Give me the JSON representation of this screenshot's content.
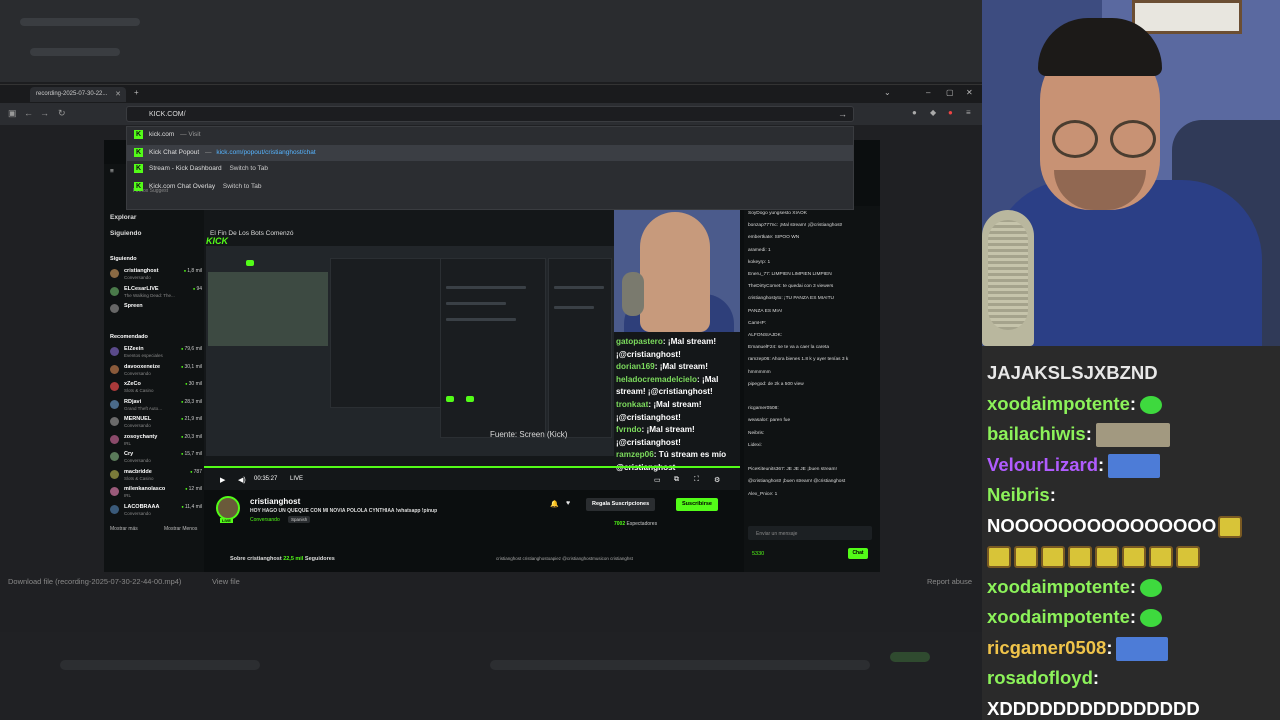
{
  "browser": {
    "tab_title": "recording-2025-07-30-22...",
    "url_value": "KICK.COM/",
    "suggestions": [
      {
        "title": "kick.com",
        "sub": "— Visit",
        "url": "",
        "action": ""
      },
      {
        "title": "Kick Chat Popout",
        "sub": "—",
        "url": "kick.com/popout/cristianghost/chat",
        "action": ""
      },
      {
        "title": "Stream - Kick Dashboard",
        "sub": "",
        "url": "",
        "action": "Switch to Tab"
      },
      {
        "title": "Kick.com Chat Overlay",
        "sub": "",
        "url": "",
        "action": "Switch to Tab"
      }
    ],
    "suggest_header": "Firefox Suggest",
    "download_text": "Download file (recording-2025-07-30-22-44-00.mp4)",
    "view_file": "View file",
    "report_abuse": "Report abuse"
  },
  "kick": {
    "nav": [
      "Explorar",
      "Siguiendo"
    ],
    "following_heading": "Siguiendo",
    "following": [
      {
        "name": "cristianghost",
        "cat": "Conversando",
        "count": "1,8 mil",
        "color": "#8a6a44"
      },
      {
        "name": "ELCesarLIVE",
        "cat": "The Walking Dead: The...",
        "count": "94",
        "color": "#4a7a4a"
      },
      {
        "name": "Spreen",
        "cat": "",
        "count": "",
        "color": "#666"
      }
    ],
    "recommended_heading": "Recomendado",
    "recommended": [
      {
        "name": "ElZeein",
        "cat": "Eventos especiales",
        "count": "79,6 mil",
        "color": "#5a4a8a"
      },
      {
        "name": "davooxeneize",
        "cat": "Conversando",
        "count": "30,1 mil",
        "color": "#8a5a3a"
      },
      {
        "name": "xZeCo",
        "cat": "Slots & Casino",
        "count": "30 mil",
        "color": "#aa3a3a"
      },
      {
        "name": "RDjavi",
        "cat": "Grand Theft Auto...",
        "count": "28,3 mil",
        "color": "#4a6a8a"
      },
      {
        "name": "MERNUEL",
        "cat": "Conversando",
        "count": "21,9 mil",
        "color": "#6a6a6a"
      },
      {
        "name": "zosoychanty",
        "cat": "IRL",
        "count": "20,3 mil",
        "color": "#8a4a6a"
      },
      {
        "name": "Cry",
        "cat": "Conversando",
        "count": "15,7 mil",
        "color": "#5a7a5a"
      },
      {
        "name": "macbridde",
        "cat": "Slots & Casino",
        "count": "787",
        "color": "#7a7a3a"
      },
      {
        "name": "milenkanolasco",
        "cat": "IRL",
        "count": "12 mil",
        "color": "#9a5a7a"
      },
      {
        "name": "LACOBRAAA",
        "cat": "Conversando",
        "count": "11,4 mil",
        "color": "#3a5a7a"
      }
    ],
    "show_more": "Mostrar más",
    "show_less": "Mostrar Menos",
    "stream_title": "El Fin De Los Bots Comenzó",
    "kick_logo": "KICK",
    "overlay_chat": [
      {
        "user": "gatopastero",
        "msg": ": ¡Mal stream! ¡@cristianghost!"
      },
      {
        "user": "dorian169",
        "msg": ": ¡Mal stream!"
      },
      {
        "user": "heladocremadelcielo",
        "msg": ": ¡Mal stream! ¡@cristianghost!"
      },
      {
        "user": "tronkaat",
        "msg": ": ¡Mal stream! ¡@cristianghost!"
      },
      {
        "user": "fvrndo",
        "msg": ": ¡Mal stream! ¡@cristianghost!"
      },
      {
        "user": "ramzep06",
        "msg": ": Tú stream es mío @cristianghost"
      }
    ],
    "source_label": "Fuente: Screen (Kick)",
    "time": "00:35:27",
    "live": "LIVE",
    "streamer": "cristianghost",
    "description": "HOY HAGO UN QUEQUE CON MI NOVIA POLOLA CYNTHIAA !whatsapp !pinup",
    "category": "Conversando",
    "language": "Spanish",
    "gift_label": "Regala Suscripciones",
    "subscribe_label": "Suscribirse",
    "viewers_count": "7002",
    "viewers_label": "Espectadores",
    "about": "Sobre cristianghost",
    "followers": "22,5 mil",
    "followers_label": "Seguidores",
    "socials": "cristianghost   cristianghostoapiez   @cristianghostmusicon   cristianghst",
    "chat_lines": [
      "SoyDogo  yungsesto  XIAOK",
      "bonzap777nc: ¡Mal stream! ¡@cristianghost!",
      "embertkate: SIPOO WN",
      "aramedi: 1",
      "kokeyrp: 1",
      "Eneru_77: LIMPIEN  LIMPIEN  LIMPIEN",
      "TheDirtyComet: te quedai con 3 viewers",
      "cristianghostyto: ¡TU PANZA ES MIA!TU",
      "PANZA ES MIA!",
      "CamHP:",
      "ALFONSIAJDK:",
      "EmanuelF24: se te va a caer la careta",
      "ramzep06: Ahora bienes 1.8 k y ayer tenías 3 k",
      "hmmmmm",
      "pipegod: de 2k a 500 view",
      "",
      "ricgamer0508:",
      "weasalor: paren  fue",
      "Neibris:",
      "Lidexi:",
      "",
      "PiceKiteunits367: JE JE JE ¡buen stream!",
      "@cristianghost! ¡buen stream! @cristianghost",
      "Alex_Pnice: 1"
    ],
    "chat_placeholder": "Enviar un mensaje",
    "points": "5330",
    "chat_button": "Chat"
  },
  "stream_chat": [
    {
      "user": "",
      "msg": "JAJAKSLSJXBZND",
      "user_color": "#ffffff",
      "emote": ""
    },
    {
      "user": "xoodaimpotente",
      "msg": ":",
      "user_color": "#8cf25a",
      "emote": "green"
    },
    {
      "user": "bailachiwis",
      "msg": ":",
      "user_color": "#8cf25a",
      "emote": "img"
    },
    {
      "user": "VelourLizard",
      "msg": ":",
      "user_color": "#b05cff",
      "emote": "car"
    },
    {
      "user": "Neibris",
      "msg": ":",
      "user_color": "#8cf25a",
      "emote": ""
    },
    {
      "user": "",
      "msg": "NOOOOOOOOOOOOOOO",
      "user_color": "#ffffff",
      "emote": "sponge1"
    },
    {
      "user": "",
      "msg": "",
      "user_color": "#ffffff",
      "emote": "sponge8"
    },
    {
      "user": "xoodaimpotente",
      "msg": ":",
      "user_color": "#8cf25a",
      "emote": "green"
    },
    {
      "user": "xoodaimpotente",
      "msg": ":",
      "user_color": "#8cf25a",
      "emote": "green"
    },
    {
      "user": "ricgamer0508",
      "msg": ":",
      "user_color": "#f0c44a",
      "emote": "car"
    },
    {
      "user": "rosadofloyd",
      "msg": ":",
      "user_color": "#8cf25a",
      "emote": ""
    },
    {
      "user": "",
      "msg": "XDDDDDDDDDDDDDDD",
      "user_color": "#ffffff",
      "emote": ""
    }
  ]
}
